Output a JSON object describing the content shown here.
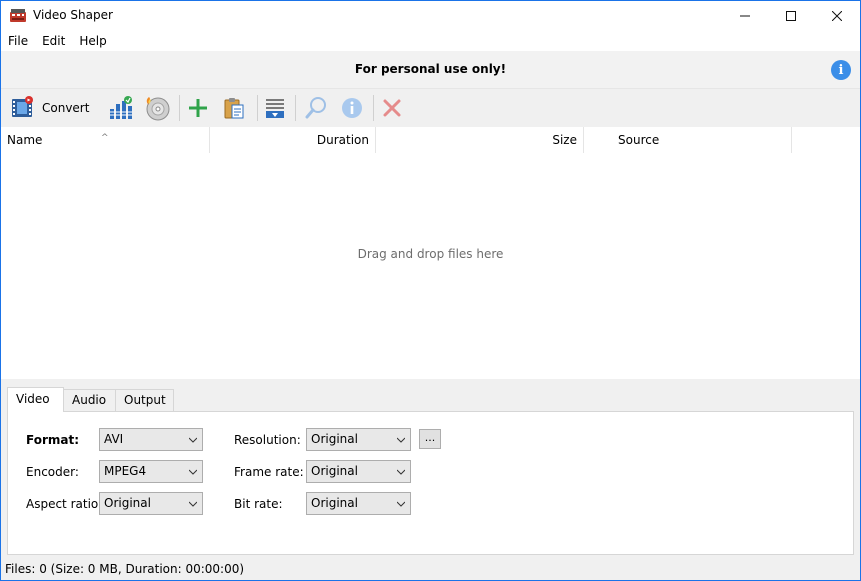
{
  "window": {
    "title": "Video Shaper",
    "minimize_glyph": "—",
    "maximize_glyph": "☐",
    "close_glyph": "✕"
  },
  "menu": {
    "items": [
      "File",
      "Edit",
      "Help"
    ]
  },
  "notice": {
    "text": "For personal use only!",
    "info_glyph": "i"
  },
  "toolbar": {
    "convert_label": "Convert",
    "icons": [
      "convert-icon",
      "equalizer-icon",
      "burn-disc-icon",
      "add-icon",
      "paste-icon",
      "save-list-icon",
      "search-icon",
      "info-icon",
      "remove-icon"
    ]
  },
  "file_list": {
    "columns": [
      "Name",
      "Duration",
      "Size",
      "Source"
    ],
    "sort_glyph": "^",
    "empty_hint": "Drag and drop files here"
  },
  "tabs": [
    "Video",
    "Audio",
    "Output"
  ],
  "video_settings": {
    "format_label": "Format:",
    "format_value": "AVI",
    "encoder_label": "Encoder:",
    "encoder_value": "MPEG4",
    "aspect_label": "Aspect ratio:",
    "aspect_value": "Original",
    "resolution_label": "Resolution:",
    "resolution_value": "Original",
    "resolution_more": "...",
    "framerate_label": "Frame rate:",
    "framerate_value": "Original",
    "bitrate_label": "Bit rate:",
    "bitrate_value": "Original"
  },
  "status": {
    "text": "Files: 0 (Size: 0 MB, Duration: 00:00:00)"
  },
  "colors": {
    "accent": "#1a73e8",
    "info_blue": "#3b8ee8",
    "add_green": "#2fa34a",
    "remove_red": "#e55b5b"
  }
}
